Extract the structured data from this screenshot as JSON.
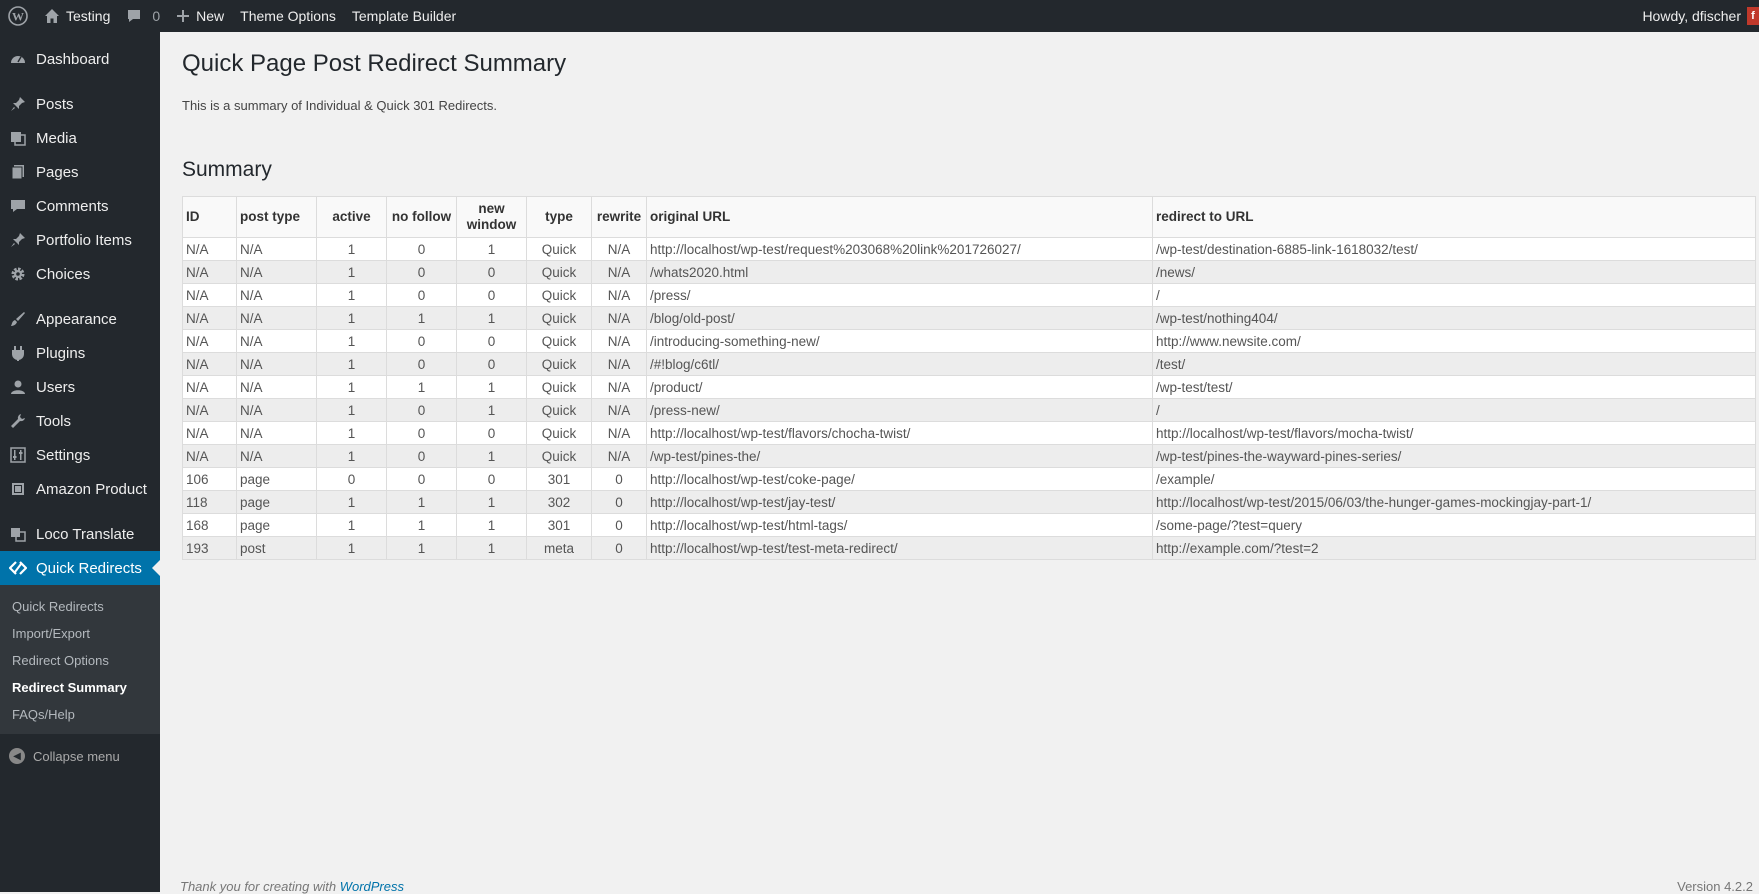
{
  "adminbar": {
    "site_name": "Testing",
    "comments_count": "0",
    "new_label": "New",
    "theme_options": "Theme Options",
    "template_builder": "Template Builder",
    "howdy": "Howdy, dfischer",
    "avatar_letter": "f"
  },
  "sidebar": {
    "items": [
      {
        "label": "Dashboard",
        "icon": "dashboard-icon"
      },
      {
        "label": "Posts",
        "icon": "pin-icon"
      },
      {
        "label": "Media",
        "icon": "media-icon"
      },
      {
        "label": "Pages",
        "icon": "pages-icon"
      },
      {
        "label": "Comments",
        "icon": "comments-icon"
      },
      {
        "label": "Portfolio Items",
        "icon": "pin-icon"
      },
      {
        "label": "Choices",
        "icon": "gear-icon"
      },
      {
        "label": "Appearance",
        "icon": "brush-icon"
      },
      {
        "label": "Plugins",
        "icon": "plugin-icon"
      },
      {
        "label": "Users",
        "icon": "user-icon"
      },
      {
        "label": "Tools",
        "icon": "wrench-icon"
      },
      {
        "label": "Settings",
        "icon": "settings-icon"
      },
      {
        "label": "Amazon Product",
        "icon": "box-icon"
      },
      {
        "label": "Loco Translate",
        "icon": "translate-icon"
      },
      {
        "label": "Quick Redirects",
        "icon": "redirect-icon"
      }
    ],
    "submenu": [
      {
        "label": "Quick Redirects"
      },
      {
        "label": "Import/Export"
      },
      {
        "label": "Redirect Options"
      },
      {
        "label": "Redirect Summary"
      },
      {
        "label": "FAQs/Help"
      }
    ],
    "collapse_label": "Collapse menu"
  },
  "main": {
    "title": "Quick Page Post Redirect Summary",
    "description": "This is a summary of Individual & Quick 301 Redirects.",
    "section_title": "Summary",
    "table": {
      "headers": [
        "ID",
        "post type",
        "active",
        "no follow",
        "new window",
        "type",
        "rewrite",
        "original URL",
        "redirect to URL"
      ],
      "rows": [
        [
          "N/A",
          "N/A",
          "1",
          "0",
          "1",
          "Quick",
          "N/A",
          "http://localhost/wp-test/request%203068%20link%201726027/",
          "/wp-test/destination-6885-link-1618032/test/"
        ],
        [
          "N/A",
          "N/A",
          "1",
          "0",
          "0",
          "Quick",
          "N/A",
          "/whats2020.html",
          "/news/"
        ],
        [
          "N/A",
          "N/A",
          "1",
          "0",
          "0",
          "Quick",
          "N/A",
          "/press/",
          "/"
        ],
        [
          "N/A",
          "N/A",
          "1",
          "1",
          "1",
          "Quick",
          "N/A",
          "/blog/old-post/",
          "/wp-test/nothing404/"
        ],
        [
          "N/A",
          "N/A",
          "1",
          "0",
          "0",
          "Quick",
          "N/A",
          "/introducing-something-new/",
          "http://www.newsite.com/"
        ],
        [
          "N/A",
          "N/A",
          "1",
          "0",
          "0",
          "Quick",
          "N/A",
          "/#!blog/c6tl/",
          "/test/"
        ],
        [
          "N/A",
          "N/A",
          "1",
          "1",
          "1",
          "Quick",
          "N/A",
          "/product/",
          "/wp-test/test/"
        ],
        [
          "N/A",
          "N/A",
          "1",
          "0",
          "1",
          "Quick",
          "N/A",
          "/press-new/",
          "/"
        ],
        [
          "N/A",
          "N/A",
          "1",
          "0",
          "0",
          "Quick",
          "N/A",
          "http://localhost/wp-test/flavors/chocha-twist/",
          "http://localhost/wp-test/flavors/mocha-twist/"
        ],
        [
          "N/A",
          "N/A",
          "1",
          "0",
          "1",
          "Quick",
          "N/A",
          "/wp-test/pines-the/",
          "/wp-test/pines-the-wayward-pines-series/"
        ],
        [
          "106",
          "page",
          "0",
          "0",
          "0",
          "301",
          "0",
          "http://localhost/wp-test/coke-page/",
          "/example/"
        ],
        [
          "118",
          "page",
          "1",
          "1",
          "1",
          "302",
          "0",
          "http://localhost/wp-test/jay-test/",
          "http://localhost/wp-test/2015/06/03/the-hunger-games-mockingjay-part-1/"
        ],
        [
          "168",
          "page",
          "1",
          "1",
          "1",
          "301",
          "0",
          "http://localhost/wp-test/html-tags/",
          "/some-page/?test=query"
        ],
        [
          "193",
          "post",
          "1",
          "1",
          "1",
          "meta",
          "0",
          "http://localhost/wp-test/test-meta-redirect/",
          "http://example.com/?test=2"
        ]
      ]
    }
  },
  "footer": {
    "thanks": "Thank you for creating with ",
    "link": "WordPress",
    "version": "Version 4.2.2"
  },
  "colors": {
    "adminbar_bg": "#23282d",
    "accent": "#0073aa",
    "page_bg": "#f1f1f1"
  }
}
